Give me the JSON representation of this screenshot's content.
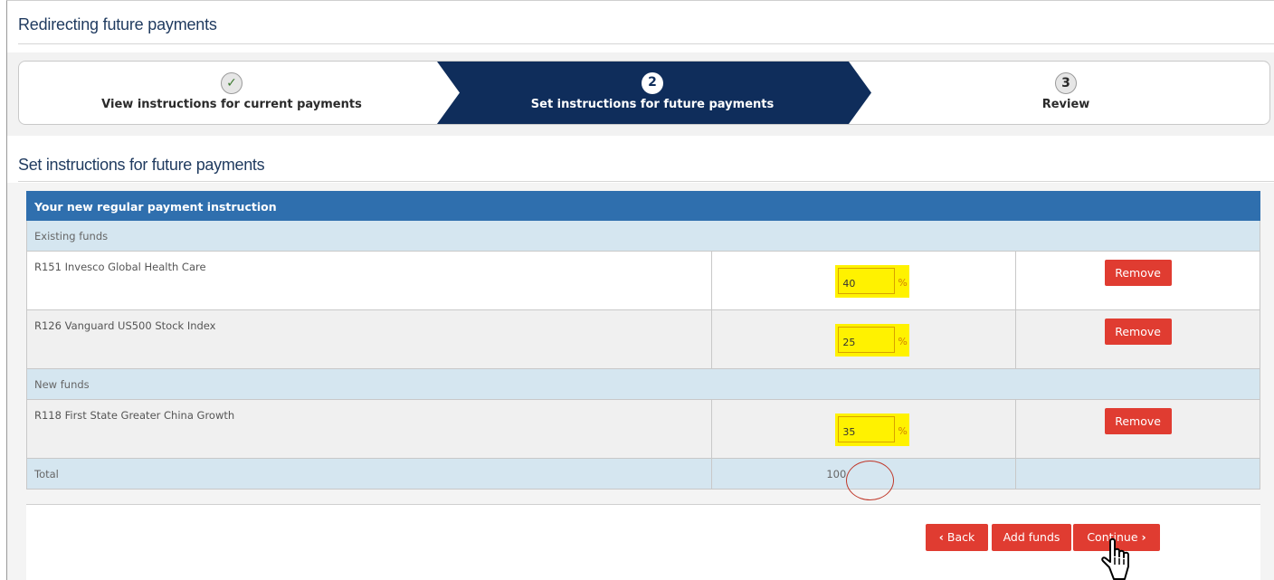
{
  "page": {
    "title": "Redirecting future payments"
  },
  "steps": [
    {
      "number": "✓",
      "label": "View instructions for current payments",
      "state": "completed"
    },
    {
      "number": "2",
      "label": "Set instructions for future payments",
      "state": "active"
    },
    {
      "number": "3",
      "label": "Review",
      "state": "upcoming"
    }
  ],
  "section": {
    "title": "Set instructions for future payments"
  },
  "table": {
    "header": "Your new regular payment instruction",
    "groups": {
      "existing": "Existing funds",
      "new": "New funds"
    },
    "rows": [
      {
        "name": "R151 Invesco Global Health Care",
        "percent": "40",
        "unit": "%",
        "action": "Remove"
      },
      {
        "name": "R126 Vanguard US500 Stock Index",
        "percent": "25",
        "unit": "%",
        "action": "Remove"
      },
      {
        "name": "R118 First State Greater China Growth",
        "percent": "35",
        "unit": "%",
        "action": "Remove"
      }
    ],
    "total": {
      "label": "Total",
      "value": "100"
    }
  },
  "buttons": {
    "back": "Back",
    "back_icon": "‹",
    "add_funds": "Add funds",
    "continue": "Continue",
    "continue_icon": "›"
  },
  "colors": {
    "active_step": "#0f2d5b",
    "table_header": "#2f6fae",
    "group_row": "#d5e6f0",
    "button": "#e03c31",
    "highlight": "#fff200",
    "annotation_circle": "#c0392b"
  }
}
